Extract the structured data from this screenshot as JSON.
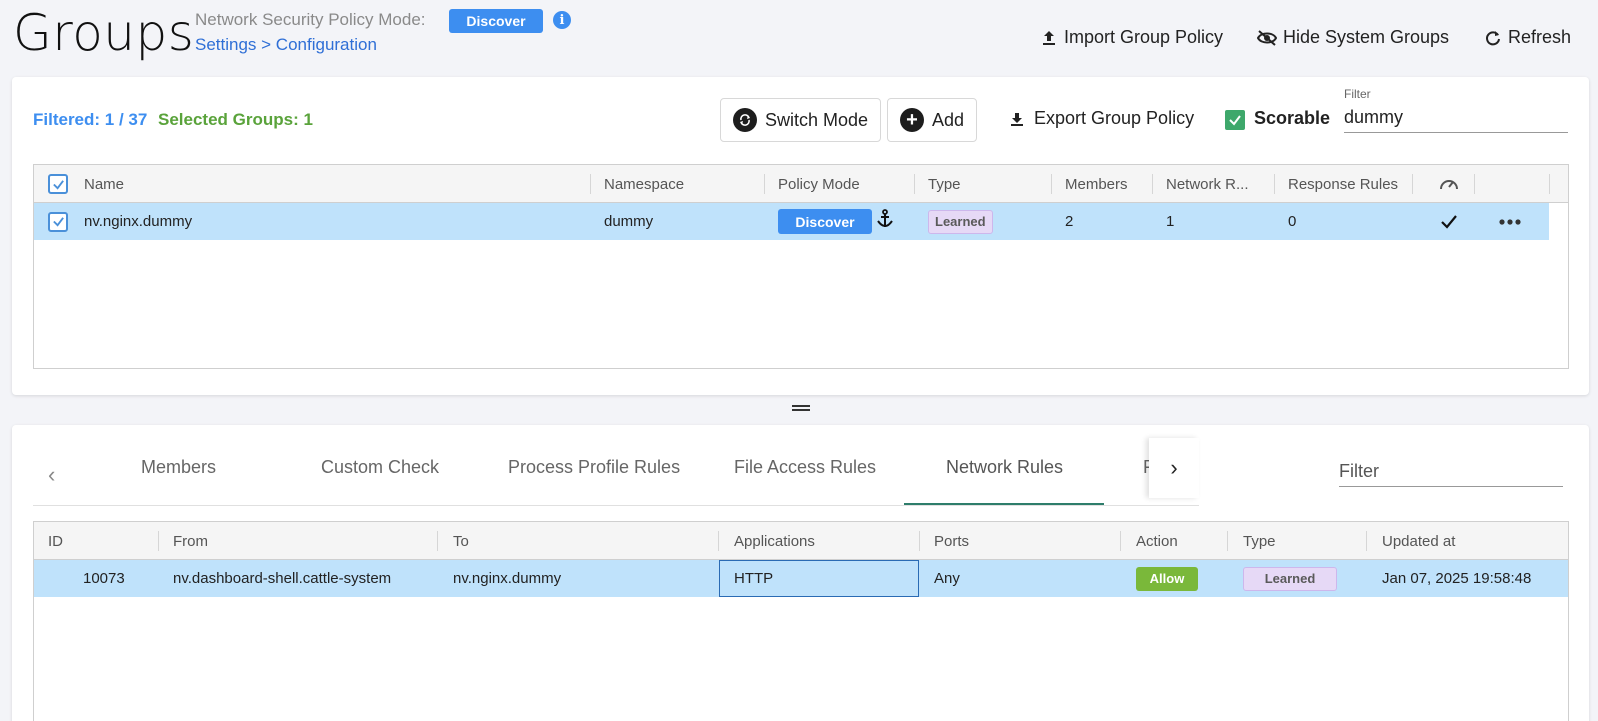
{
  "header": {
    "title": "Groups",
    "mode_label": "Network Security Policy Mode:",
    "mode_value": "Discover",
    "breadcrumb": "Settings > Configuration",
    "actions": {
      "import": "Import Group Policy",
      "hide_system": "Hide System Groups",
      "refresh": "Refresh"
    }
  },
  "groups_panel": {
    "filtered_text": "Filtered: 1 / 37",
    "selected_text": "Selected Groups:  1",
    "switch_mode": "Switch Mode",
    "add": "Add",
    "export": "Export Group Policy",
    "scorable": "Scorable",
    "filter_label": "Filter",
    "filter_value": "dummy",
    "columns": [
      "Name",
      "Namespace",
      "Policy Mode",
      "Type",
      "Members",
      "Network R...",
      "Response Rules"
    ],
    "rows": [
      {
        "name": "nv.nginx.dummy",
        "namespace": "dummy",
        "policy_mode": "Discover",
        "type": "Learned",
        "members": "2",
        "network_rules": "1",
        "response_rules": "0"
      }
    ]
  },
  "details_panel": {
    "tabs": [
      "Members",
      "Custom Check",
      "Process Profile Rules",
      "File Access Rules",
      "Network Rules",
      "F"
    ],
    "active_tab": "Network Rules",
    "filter_placeholder": "Filter",
    "columns": [
      "ID",
      "From",
      "To",
      "Applications",
      "Ports",
      "Action",
      "Type",
      "Updated at"
    ],
    "rows": [
      {
        "id": "10073",
        "from": "nv.dashboard-shell.cattle-system",
        "to": "nv.nginx.dummy",
        "applications": "HTTP",
        "ports": "Any",
        "action": "Allow",
        "type": "Learned",
        "updated_at": "Jan 07, 2025 19:58:48"
      }
    ]
  },
  "colors": {
    "accent_blue": "#3d8ef0",
    "green": "#5aa33b",
    "row_selected": "#bfe2fb",
    "learned_bg": "#e6d9f6",
    "allow_bg": "#7ab83a",
    "tab_underline": "#2e7d6b"
  }
}
